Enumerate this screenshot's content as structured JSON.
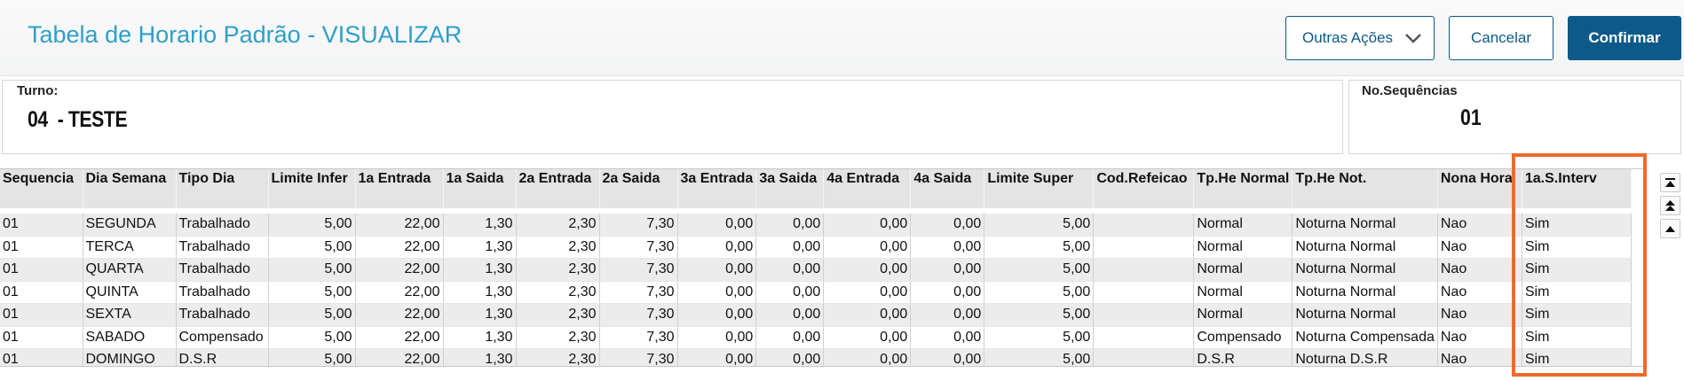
{
  "header": {
    "title": "Tabela de Horario Padrão - VISUALIZAR",
    "more_actions_label": "Outras Ações",
    "cancel_label": "Cancelar",
    "confirm_label": "Confirmar"
  },
  "fields": {
    "turno_label": "Turno:",
    "turno_value": "04  - TESTE",
    "seq_label": "No.Sequências",
    "seq_value": "01"
  },
  "grid": {
    "columns": [
      "Sequencia",
      "Dia Semana",
      "Tipo Dia",
      "Limite Infer",
      "1a Entrada",
      "1a Saida",
      "2a Entrada",
      "2a Saida",
      "3a Entrada",
      "3a Saida",
      "4a Entrada",
      "4a Saida",
      "Limite Super",
      "Cod.Refeicao",
      "Tp.He Normal",
      "Tp.He Not.",
      "Nona Hora",
      "1a.S.Interv"
    ],
    "rows": [
      [
        "01",
        "SEGUNDA",
        "Trabalhado",
        "5,00",
        "22,00",
        "1,30",
        "2,30",
        "7,30",
        "0,00",
        "0,00",
        "0,00",
        "0,00",
        "5,00",
        "",
        "Normal",
        "Noturna Normal",
        "Nao",
        "Sim"
      ],
      [
        "01",
        "TERCA",
        "Trabalhado",
        "5,00",
        "22,00",
        "1,30",
        "2,30",
        "7,30",
        "0,00",
        "0,00",
        "0,00",
        "0,00",
        "5,00",
        "",
        "Normal",
        "Noturna Normal",
        "Nao",
        "Sim"
      ],
      [
        "01",
        "QUARTA",
        "Trabalhado",
        "5,00",
        "22,00",
        "1,30",
        "2,30",
        "7,30",
        "0,00",
        "0,00",
        "0,00",
        "0,00",
        "5,00",
        "",
        "Normal",
        "Noturna Normal",
        "Nao",
        "Sim"
      ],
      [
        "01",
        "QUINTA",
        "Trabalhado",
        "5,00",
        "22,00",
        "1,30",
        "2,30",
        "7,30",
        "0,00",
        "0,00",
        "0,00",
        "0,00",
        "5,00",
        "",
        "Normal",
        "Noturna Normal",
        "Nao",
        "Sim"
      ],
      [
        "01",
        "SEXTA",
        "Trabalhado",
        "5,00",
        "22,00",
        "1,30",
        "2,30",
        "7,30",
        "0,00",
        "0,00",
        "0,00",
        "0,00",
        "5,00",
        "",
        "Normal",
        "Noturna Normal",
        "Nao",
        "Sim"
      ],
      [
        "01",
        "SABADO",
        "Compensado",
        "5,00",
        "22,00",
        "1,30",
        "2,30",
        "7,30",
        "0,00",
        "0,00",
        "0,00",
        "0,00",
        "5,00",
        "",
        "Compensado",
        "Noturna Compensada",
        "Nao",
        "Sim"
      ],
      [
        "01",
        "DOMINGO",
        "D.S.R",
        "5,00",
        "22,00",
        "1,30",
        "2,30",
        "7,30",
        "0,00",
        "0,00",
        "0,00",
        "0,00",
        "5,00",
        "",
        "D.S.R",
        "Noturna D.S.R",
        "Nao",
        "Sim"
      ]
    ]
  },
  "scroll_icons": [
    "scroll-to-top-icon",
    "page-up-icon",
    "row-up-icon"
  ],
  "colors": {
    "accent": "#0d5a8a",
    "title": "#2f9fc9",
    "highlight": "#ee6a2e"
  }
}
